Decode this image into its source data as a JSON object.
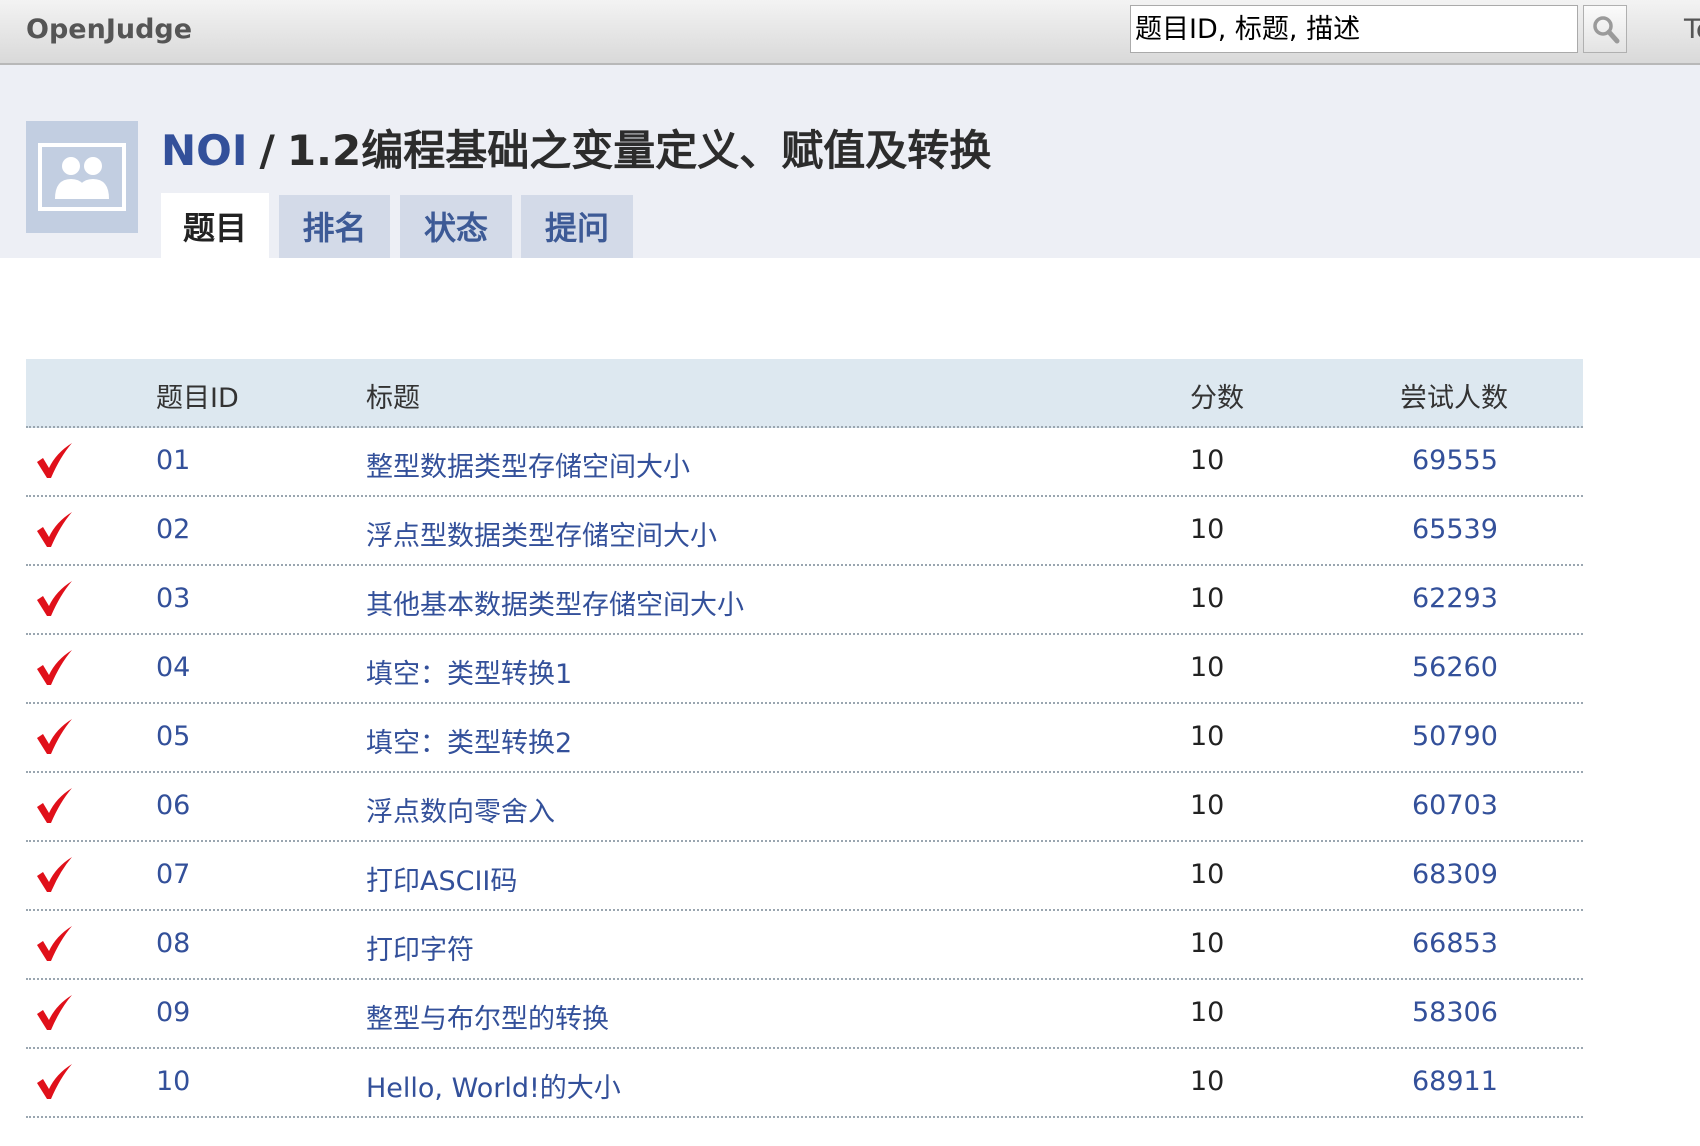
{
  "site": {
    "brand": "OpenJudge",
    "top_link": "Te"
  },
  "search": {
    "placeholder": "题目ID, 标题, 描述"
  },
  "breadcrumb": {
    "group": "NOI",
    "separator": "/",
    "page_title": "1.2编程基础之变量定义、赋值及转换"
  },
  "tabs": [
    {
      "label": "题目",
      "active": true
    },
    {
      "label": "排名",
      "active": false
    },
    {
      "label": "状态",
      "active": false
    },
    {
      "label": "提问",
      "active": false
    }
  ],
  "table": {
    "headers": {
      "id": "题目ID",
      "title": "标题",
      "score": "分数",
      "tries": "尝试人数"
    },
    "rows": [
      {
        "solved": true,
        "id": "01",
        "title": "整型数据类型存储空间大小",
        "score": "10",
        "tries": "69555"
      },
      {
        "solved": true,
        "id": "02",
        "title": "浮点型数据类型存储空间大小",
        "score": "10",
        "tries": "65539"
      },
      {
        "solved": true,
        "id": "03",
        "title": "其他基本数据类型存储空间大小",
        "score": "10",
        "tries": "62293"
      },
      {
        "solved": true,
        "id": "04",
        "title": "填空：类型转换1",
        "score": "10",
        "tries": "56260"
      },
      {
        "solved": true,
        "id": "05",
        "title": "填空：类型转换2",
        "score": "10",
        "tries": "50790"
      },
      {
        "solved": true,
        "id": "06",
        "title": "浮点数向零舍入",
        "score": "10",
        "tries": "60703"
      },
      {
        "solved": true,
        "id": "07",
        "title": "打印ASCII码",
        "score": "10",
        "tries": "68309"
      },
      {
        "solved": true,
        "id": "08",
        "title": "打印字符",
        "score": "10",
        "tries": "66853"
      },
      {
        "solved": true,
        "id": "09",
        "title": "整型与布尔型的转换",
        "score": "10",
        "tries": "58306"
      },
      {
        "solved": true,
        "id": "10",
        "title": "Hello, World!的大小",
        "score": "10",
        "tries": "68911"
      }
    ]
  },
  "colors": {
    "link": "#33509a",
    "check": "#e0101a",
    "header_bg": "#dde8f0",
    "band_bg": "#edeff5"
  },
  "icons": {
    "search": "search-icon",
    "solved": "check-icon",
    "group": "group-avatar-icon"
  }
}
